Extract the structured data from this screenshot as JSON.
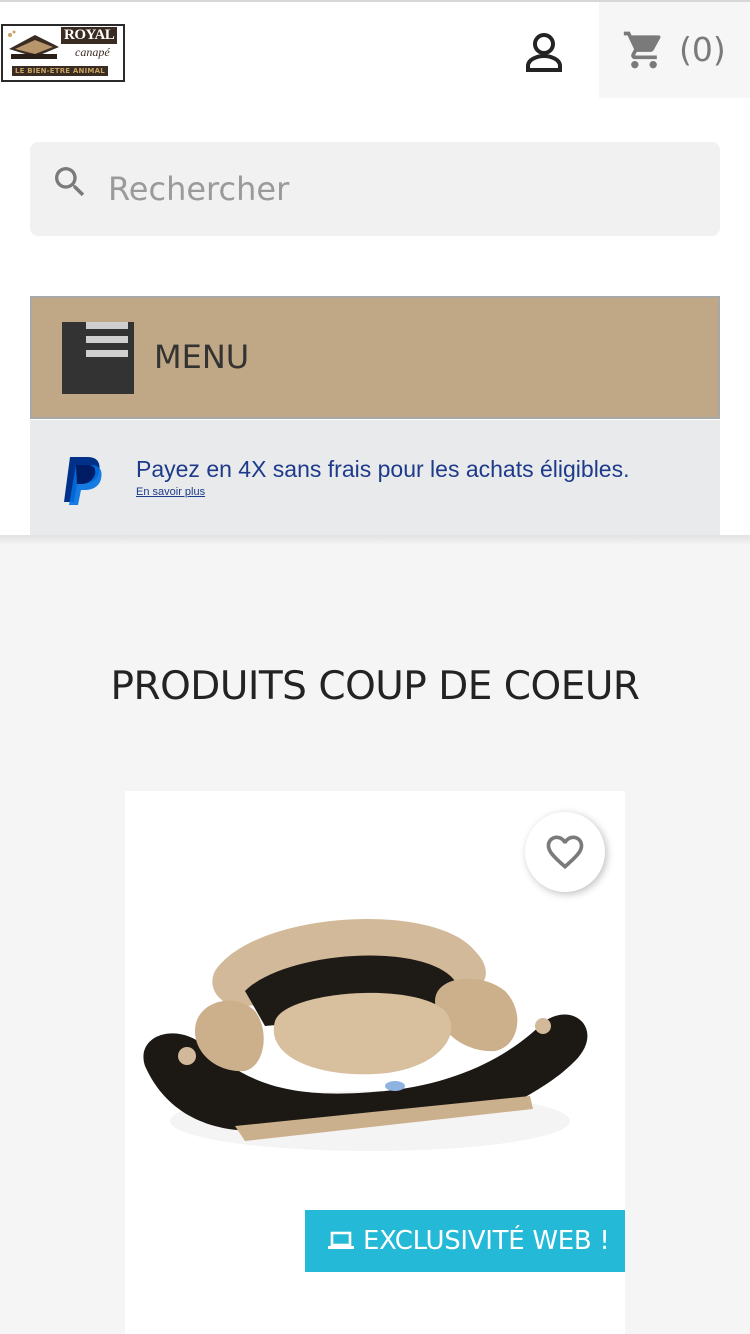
{
  "header": {
    "logo": {
      "brand": "ROYAL",
      "subtitle": "canapé",
      "tagline": "LE BIEN-ETRE ANIMAL"
    },
    "account_icon": "user-icon",
    "cart": {
      "icon": "shopping-cart-icon",
      "count": "(0)"
    }
  },
  "search": {
    "placeholder": "Rechercher",
    "value": "",
    "icon": "search-icon"
  },
  "menu": {
    "label": "MENU",
    "icon": "hamburger-icon"
  },
  "paypal": {
    "message": "Payez en 4X sans frais pour les achats éligibles.",
    "link": "En savoir plus"
  },
  "featured": {
    "title": "PRODUITS COUP DE COEUR",
    "product": {
      "badge": "EXCLUSIVITÉ WEB !",
      "badge_icon": "laptop-icon",
      "wishlist_icon": "heart-icon"
    }
  },
  "colors": {
    "menu_bg": "#c0a785",
    "badge_bg": "#24b9d7",
    "paypal_text": "#1e3a8a",
    "page_bg": "#f5f5f5"
  }
}
